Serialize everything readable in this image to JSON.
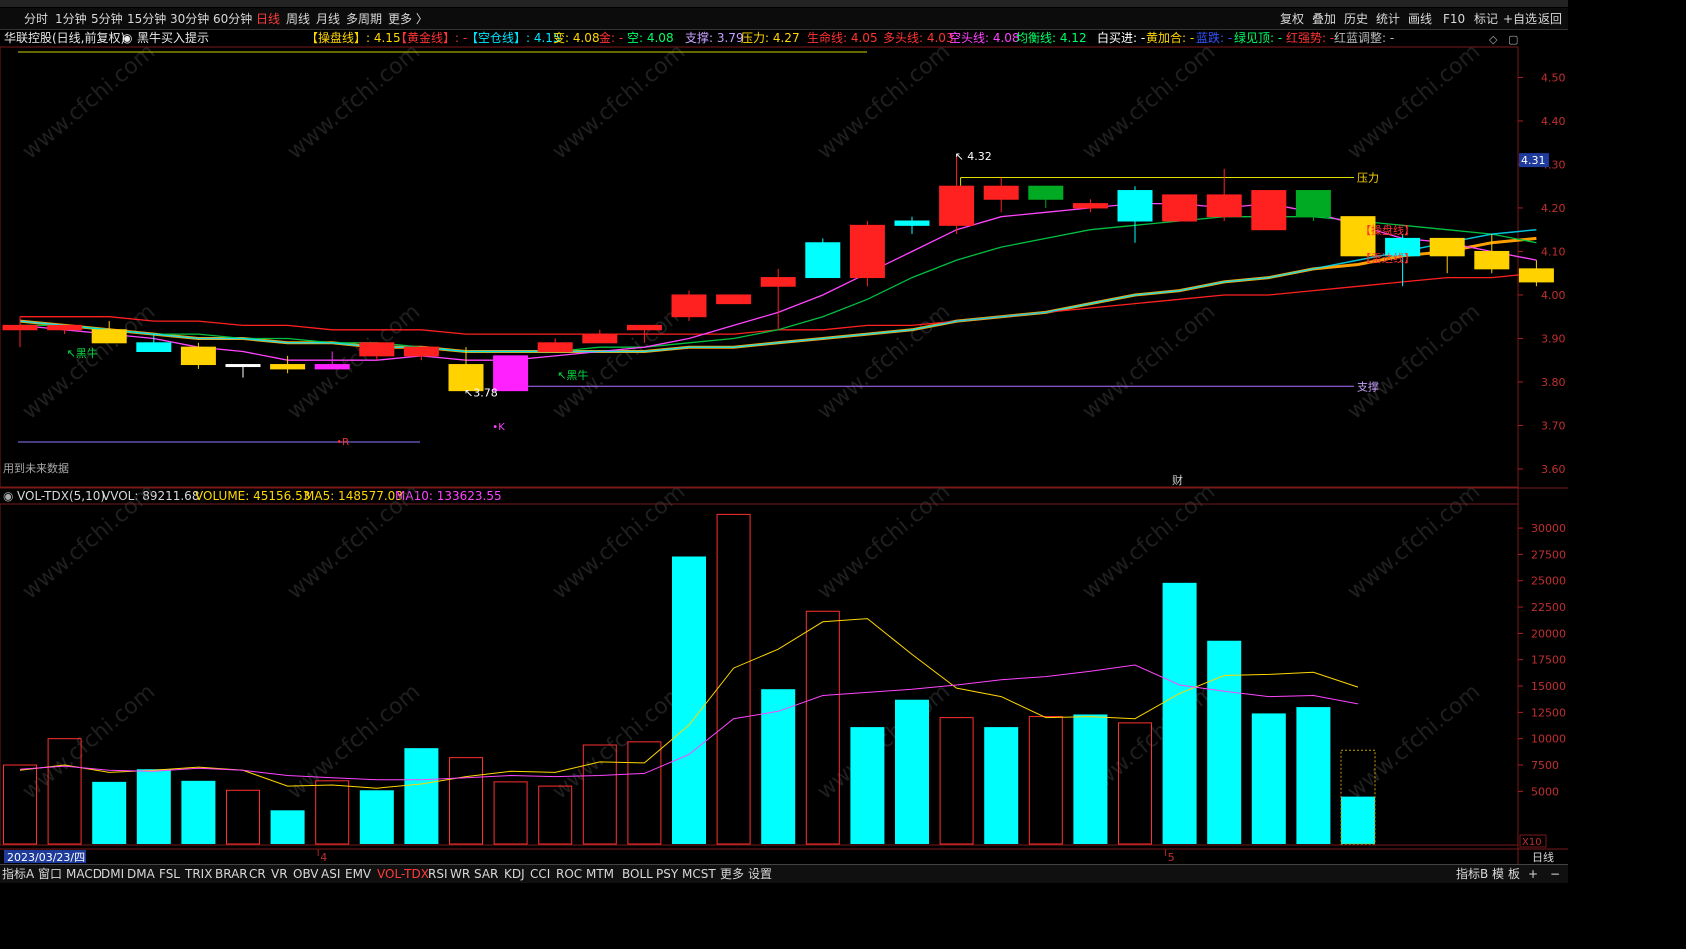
{
  "app": {
    "stock_title": "华联控股(日线,前复权)",
    "indicator_name": "黑牛买入提示",
    "future_data_note": "用到未来数据",
    "watermark": "www.cfchi.com",
    "caption_label": "财"
  },
  "periods": {
    "items": [
      "分时",
      "1分钟",
      "5分钟",
      "15分钟",
      "30分钟",
      "60分钟",
      "日线",
      "周线",
      "月线",
      "多周期",
      "更多 〉"
    ],
    "active": "日线"
  },
  "toolbar_right": [
    "复权",
    "叠加",
    "历史",
    "统计",
    "画线",
    "F10",
    "标记",
    "+自选",
    "返回"
  ],
  "info": [
    {
      "text": "【操盘线】: 4.15",
      "color": "#ffd700"
    },
    {
      "text": "【黄金线】: -",
      "color": "#ff3333"
    },
    {
      "text": "【空仓线】: 4.15",
      "color": "#00e5ff"
    },
    {
      "text": "变: 4.08",
      "color": "#ffd700"
    },
    {
      "text": "金: -",
      "color": "#ff3333"
    },
    {
      "text": "空: 4.08",
      "color": "#00ff66"
    },
    {
      "text": "支撑: 3.79",
      "color": "#c8a0ff"
    },
    {
      "text": "压力: 4.27",
      "color": "#ffd700"
    },
    {
      "text": "生命线: 4.05",
      "color": "#ff3333"
    },
    {
      "text": "多头线: 4.03",
      "color": "#ff3333"
    },
    {
      "text": "空头线: 4.08",
      "color": "#ff44ff"
    },
    {
      "text": "均衡线: 4.12",
      "color": "#00ff66"
    },
    {
      "text": "白买进: -",
      "color": "#ffffff"
    },
    {
      "text": "黄加合: -",
      "color": "#ffd700"
    },
    {
      "text": "蓝跌: -",
      "color": "#3355ff"
    },
    {
      "text": "绿见顶: -",
      "color": "#00ff66"
    },
    {
      "text": "红强势: -",
      "color": "#ff3333"
    },
    {
      "text": "红蓝调整: -",
      "color": "#bbbbbb"
    }
  ],
  "sub_info": [
    {
      "text": "VOL-TDX(5,10)",
      "color": "#d8d8d8"
    },
    {
      "text": "VVOL: 89211.68",
      "color": "#d8d8d8"
    },
    {
      "text": "VOLUME: 45156.53",
      "color": "#ffd700"
    },
    {
      "text": "MA5: 148577.03",
      "color": "#ffd700"
    },
    {
      "text": "MA10: 133623.55",
      "color": "#ff44ff"
    }
  ],
  "bottom_tabs": {
    "items": [
      "指标A",
      "窗口",
      "MACD",
      "DMI",
      "DMA",
      "FSL",
      "TRIX",
      "BRAR",
      "CR",
      "VR",
      "OBV",
      "ASI",
      "EMV",
      "VOL-TDX",
      "RSI",
      "WR",
      "SAR",
      "KDJ",
      "CCI",
      "ROC",
      "MTM",
      "BOLL",
      "PSY",
      "MCST",
      "更多",
      "设置"
    ],
    "active": "VOL-TDX",
    "right": [
      "指标B",
      "模",
      "板",
      "+",
      "−"
    ]
  },
  "x_axis": {
    "date_label": "2023/03/23/四",
    "month_marks": [
      {
        "index": 7,
        "label": "4"
      },
      {
        "index": 26,
        "label": "5"
      }
    ],
    "period_label": "日线"
  },
  "chart_data": [
    {
      "type": "candlestick",
      "ylim": [
        3.57,
        4.57
      ],
      "y_ticks": [
        3.6,
        3.7,
        3.8,
        3.9,
        4.0,
        4.1,
        4.2,
        4.3,
        4.4,
        4.5
      ],
      "last_price": 4.31,
      "candles": [
        {
          "o": 3.93,
          "h": 3.95,
          "l": 3.88,
          "c": 3.92,
          "s": "red"
        },
        {
          "o": 3.93,
          "h": 3.93,
          "l": 3.91,
          "c": 3.92,
          "s": "red"
        },
        {
          "o": 3.92,
          "h": 3.94,
          "l": 3.89,
          "c": 3.89,
          "s": "yellow"
        },
        {
          "o": 3.89,
          "h": 3.91,
          "l": 3.87,
          "c": 3.87,
          "s": "cyan"
        },
        {
          "o": 3.88,
          "h": 3.89,
          "l": 3.83,
          "c": 3.84,
          "s": "yellow"
        },
        {
          "o": 3.84,
          "h": 3.84,
          "l": 3.81,
          "c": 3.84,
          "s": "white"
        },
        {
          "o": 3.84,
          "h": 3.86,
          "l": 3.82,
          "c": 3.83,
          "s": "yellow"
        },
        {
          "o": 3.83,
          "h": 3.87,
          "l": 3.83,
          "c": 3.84,
          "s": "magenta"
        },
        {
          "o": 3.86,
          "h": 3.89,
          "l": 3.85,
          "c": 3.89,
          "s": "red"
        },
        {
          "o": 3.86,
          "h": 3.88,
          "l": 3.85,
          "c": 3.88,
          "s": "red"
        },
        {
          "o": 3.84,
          "h": 3.88,
          "l": 3.78,
          "c": 3.78,
          "s": "yellow"
        },
        {
          "o": 3.78,
          "h": 3.86,
          "l": 3.78,
          "c": 3.86,
          "s": "magenta"
        },
        {
          "o": 3.87,
          "h": 3.9,
          "l": 3.87,
          "c": 3.89,
          "s": "red"
        },
        {
          "o": 3.89,
          "h": 3.92,
          "l": 3.89,
          "c": 3.91,
          "s": "red"
        },
        {
          "o": 3.92,
          "h": 3.93,
          "l": 3.89,
          "c": 3.93,
          "s": "red"
        },
        {
          "o": 3.95,
          "h": 4.01,
          "l": 3.94,
          "c": 4.0,
          "s": "red"
        },
        {
          "o": 3.98,
          "h": 4.0,
          "l": 3.98,
          "c": 4.0,
          "s": "red"
        },
        {
          "o": 4.02,
          "h": 4.06,
          "l": 3.92,
          "c": 4.04,
          "s": "red"
        },
        {
          "o": 4.04,
          "h": 4.13,
          "l": 4.04,
          "c": 4.12,
          "s": "cyan"
        },
        {
          "o": 4.04,
          "h": 4.17,
          "l": 4.02,
          "c": 4.16,
          "s": "red"
        },
        {
          "o": 4.16,
          "h": 4.18,
          "l": 4.14,
          "c": 4.17,
          "s": "cyan"
        },
        {
          "o": 4.16,
          "h": 4.32,
          "l": 4.14,
          "c": 4.25,
          "s": "red"
        },
        {
          "o": 4.25,
          "h": 4.27,
          "l": 4.19,
          "c": 4.22,
          "s": "red"
        },
        {
          "o": 4.25,
          "h": 4.25,
          "l": 4.2,
          "c": 4.22,
          "s": "green"
        },
        {
          "o": 4.21,
          "h": 4.22,
          "l": 4.19,
          "c": 4.2,
          "s": "red"
        },
        {
          "o": 4.17,
          "h": 4.25,
          "l": 4.12,
          "c": 4.24,
          "s": "cyan"
        },
        {
          "o": 4.23,
          "h": 4.23,
          "l": 4.17,
          "c": 4.17,
          "s": "red"
        },
        {
          "o": 4.23,
          "h": 4.29,
          "l": 4.17,
          "c": 4.18,
          "s": "red"
        },
        {
          "o": 4.24,
          "h": 4.24,
          "l": 4.15,
          "c": 4.15,
          "s": "red"
        },
        {
          "o": 4.24,
          "h": 4.24,
          "l": 4.17,
          "c": 4.18,
          "s": "green"
        },
        {
          "o": 4.18,
          "h": 4.18,
          "l": 4.09,
          "c": 4.09,
          "s": "yellow"
        },
        {
          "o": 4.09,
          "h": 4.14,
          "l": 4.02,
          "c": 4.13,
          "s": "cyan"
        },
        {
          "o": 4.13,
          "h": 4.13,
          "l": 4.05,
          "c": 4.09,
          "s": "yellow"
        },
        {
          "o": 4.1,
          "h": 4.14,
          "l": 4.05,
          "c": 4.06,
          "s": "yellow"
        },
        {
          "o": 4.06,
          "h": 4.08,
          "l": 4.02,
          "c": 4.03,
          "s": "yellow"
        }
      ],
      "lines": [
        {
          "name": "操盘线",
          "color": "#ffa000",
          "values": [
            3.94,
            3.93,
            3.92,
            3.91,
            3.9,
            3.9,
            3.89,
            3.89,
            3.88,
            3.88,
            3.87,
            3.87,
            3.87,
            3.87,
            3.87,
            3.88,
            3.88,
            3.89,
            3.9,
            3.91,
            3.92,
            3.94,
            3.95,
            3.96,
            3.98,
            4.0,
            4.01,
            4.03,
            4.04,
            4.06,
            4.07,
            4.09,
            4.1,
            4.12,
            4.13
          ]
        },
        {
          "name": "生命线",
          "color": "#ff2020",
          "values": [
            3.95,
            3.95,
            3.95,
            3.94,
            3.94,
            3.93,
            3.93,
            3.92,
            3.92,
            3.92,
            3.91,
            3.91,
            3.91,
            3.91,
            3.91,
            3.91,
            3.91,
            3.92,
            3.92,
            3.93,
            3.93,
            3.94,
            3.95,
            3.96,
            3.97,
            3.98,
            3.99,
            4.0,
            4.0,
            4.01,
            4.02,
            4.03,
            4.04,
            4.04,
            4.05
          ]
        },
        {
          "name": "均衡线",
          "color": "#00c040",
          "values": [
            3.93,
            3.93,
            3.92,
            3.91,
            3.91,
            3.9,
            3.9,
            3.89,
            3.89,
            3.88,
            3.87,
            3.87,
            3.87,
            3.88,
            3.88,
            3.89,
            3.9,
            3.92,
            3.95,
            3.99,
            4.04,
            4.08,
            4.11,
            4.13,
            4.15,
            4.16,
            4.17,
            4.18,
            4.18,
            4.18,
            4.17,
            4.16,
            4.15,
            4.14,
            4.12
          ]
        },
        {
          "name": "空头线",
          "color": "#ff44ff",
          "values": [
            3.93,
            3.92,
            3.91,
            3.9,
            3.88,
            3.87,
            3.85,
            3.85,
            3.85,
            3.86,
            3.85,
            3.85,
            3.86,
            3.87,
            3.88,
            3.9,
            3.93,
            3.96,
            4.0,
            4.05,
            4.1,
            4.15,
            4.18,
            4.19,
            4.2,
            4.21,
            4.21,
            4.2,
            4.21,
            4.19,
            4.16,
            4.13,
            4.12,
            4.1,
            4.08
          ]
        },
        {
          "name": "空仓线",
          "color": "#00e5ff",
          "values": [
            3.94,
            3.93,
            3.92,
            3.91,
            3.9,
            3.9,
            3.89,
            3.89,
            3.88,
            3.88,
            3.87,
            3.87,
            3.87,
            3.87,
            3.87,
            3.88,
            3.88,
            3.89,
            3.9,
            3.91,
            3.92,
            3.94,
            3.95,
            3.96,
            3.98,
            4.0,
            4.01,
            4.03,
            4.04,
            4.06,
            4.08,
            4.1,
            4.12,
            4.14,
            4.15
          ]
        }
      ],
      "resistance": {
        "label": "压力",
        "value": 4.27
      },
      "support": {
        "label": "支撑",
        "value": 3.79
      },
      "tag_caopan": "【操盘线】",
      "tag_leida": "【雷达线】",
      "signal_label": "黑牛",
      "signals": [
        {
          "index": 1,
          "price": 3.85
        },
        {
          "index": 12,
          "price": 3.8
        }
      ],
      "high_mark": {
        "index": 21,
        "text": "4.32"
      },
      "low_mark": {
        "index": 10,
        "text": "3.78"
      },
      "k_marks": [
        {
          "text": "R",
          "index": 7,
          "price": 3.655,
          "color": "#ff3333"
        },
        {
          "text": "K",
          "index": 10.5,
          "price": 3.69,
          "color": "#ff44ff"
        }
      ]
    },
    {
      "type": "bar",
      "ylim": [
        0,
        32000
      ],
      "y_ticks": [
        5000,
        7500,
        10000,
        12500,
        15000,
        17500,
        20000,
        22500,
        25000,
        27500,
        30000
      ],
      "y_unit": "X10",
      "bars": [
        {
          "v": 7500,
          "s": "hollow"
        },
        {
          "v": 10000,
          "s": "hollow"
        },
        {
          "v": 5900,
          "s": "solid"
        },
        {
          "v": 7100,
          "s": "solid"
        },
        {
          "v": 6000,
          "s": "solid"
        },
        {
          "v": 5100,
          "s": "hollow"
        },
        {
          "v": 3200,
          "s": "solid"
        },
        {
          "v": 6000,
          "s": "hollow"
        },
        {
          "v": 5100,
          "s": "solid"
        },
        {
          "v": 9100,
          "s": "solid"
        },
        {
          "v": 8200,
          "s": "hollow"
        },
        {
          "v": 5900,
          "s": "hollow"
        },
        {
          "v": 5500,
          "s": "hollow"
        },
        {
          "v": 9400,
          "s": "hollow"
        },
        {
          "v": 9700,
          "s": "hollow"
        },
        {
          "v": 27300,
          "s": "solid"
        },
        {
          "v": 31300,
          "s": "hollow"
        },
        {
          "v": 14700,
          "s": "solid"
        },
        {
          "v": 22100,
          "s": "hollow"
        },
        {
          "v": 11100,
          "s": "solid"
        },
        {
          "v": 13700,
          "s": "solid"
        },
        {
          "v": 12000,
          "s": "hollow"
        },
        {
          "v": 11100,
          "s": "solid"
        },
        {
          "v": 12100,
          "s": "hollow"
        },
        {
          "v": 12300,
          "s": "solid"
        },
        {
          "v": 11500,
          "s": "hollow"
        },
        {
          "v": 24800,
          "s": "solid"
        },
        {
          "v": 19300,
          "s": "solid"
        },
        {
          "v": 12400,
          "s": "solid"
        },
        {
          "v": 13000,
          "s": "solid"
        },
        {
          "v": 4500,
          "s": "solid"
        }
      ],
      "projected_last": 8900,
      "series": [
        {
          "name": "MA5",
          "color": "#ffd700",
          "values": [
            7000,
            7500,
            6800,
            7000,
            7300,
            7000,
            5500,
            5600,
            5300,
            5700,
            6400,
            6900,
            6800,
            7800,
            7700,
            11300,
            16700,
            18500,
            21100,
            21400,
            18000,
            14800,
            14000,
            12000,
            12100,
            11900,
            14300,
            16000,
            16100,
            16300,
            14900
          ]
        },
        {
          "name": "MA10",
          "color": "#ff44ff",
          "values": [
            7100,
            7400,
            7000,
            6900,
            7200,
            7000,
            6500,
            6300,
            6100,
            6100,
            6300,
            6500,
            6400,
            6500,
            6700,
            8500,
            11900,
            12600,
            14100,
            14400,
            14700,
            15100,
            15600,
            15900,
            16400,
            17000,
            15100,
            14500,
            14000,
            14100,
            13300
          ]
        }
      ]
    }
  ]
}
